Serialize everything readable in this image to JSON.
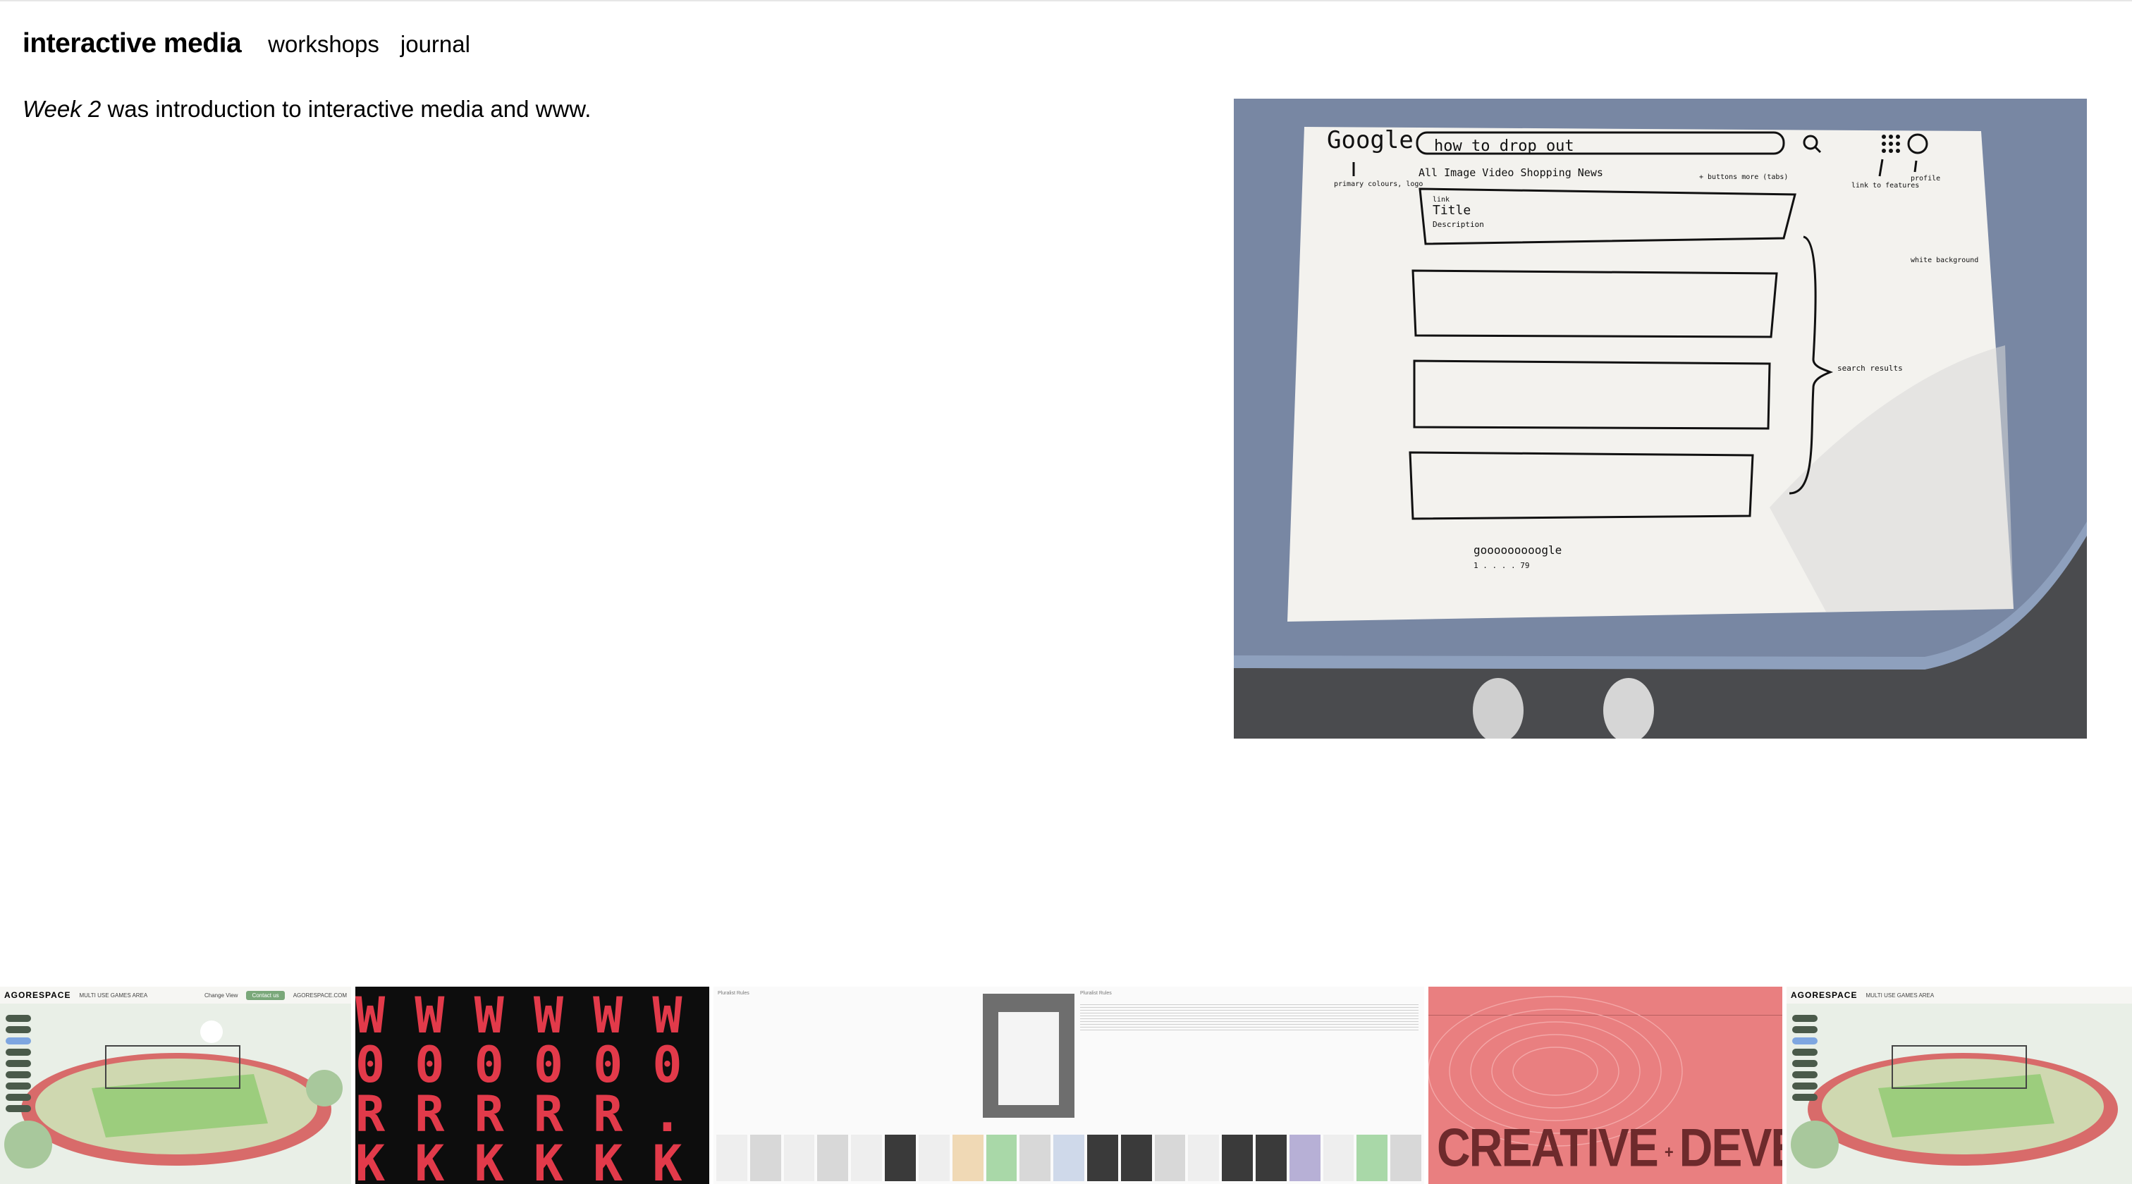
{
  "nav": {
    "brand": "interactive media",
    "links": [
      "workshops",
      "journal"
    ]
  },
  "intro": {
    "emphasis": "Week 2",
    "text": " was introduction to interactive media and www."
  },
  "sketch": {
    "logo": "Google",
    "search_query": "how to drop out",
    "tabs": "All   Image   Video   Shopping   News",
    "note_tabs": "+ buttons more (tabs)",
    "note_logo": "primary colours, logo",
    "note_links": "link to features",
    "note_profile": "profile",
    "note_bg": "white background",
    "note_results": "search results",
    "result_title": "link",
    "result_title2": "Title",
    "result_desc": "Description",
    "footer_logo": "gooooooooogle",
    "pager": "1 . . . . 79"
  },
  "strip": {
    "agorespace": {
      "logo": "AGORESPACE",
      "subtitle": "MULTI USE GAMES AREA",
      "change_view": "Change View",
      "contact": "Contact us",
      "site": "AGORESPACE.COM"
    },
    "creative": {
      "word1": "CREATIVE",
      "plus": "+",
      "word2": "DEVELOPER"
    }
  }
}
